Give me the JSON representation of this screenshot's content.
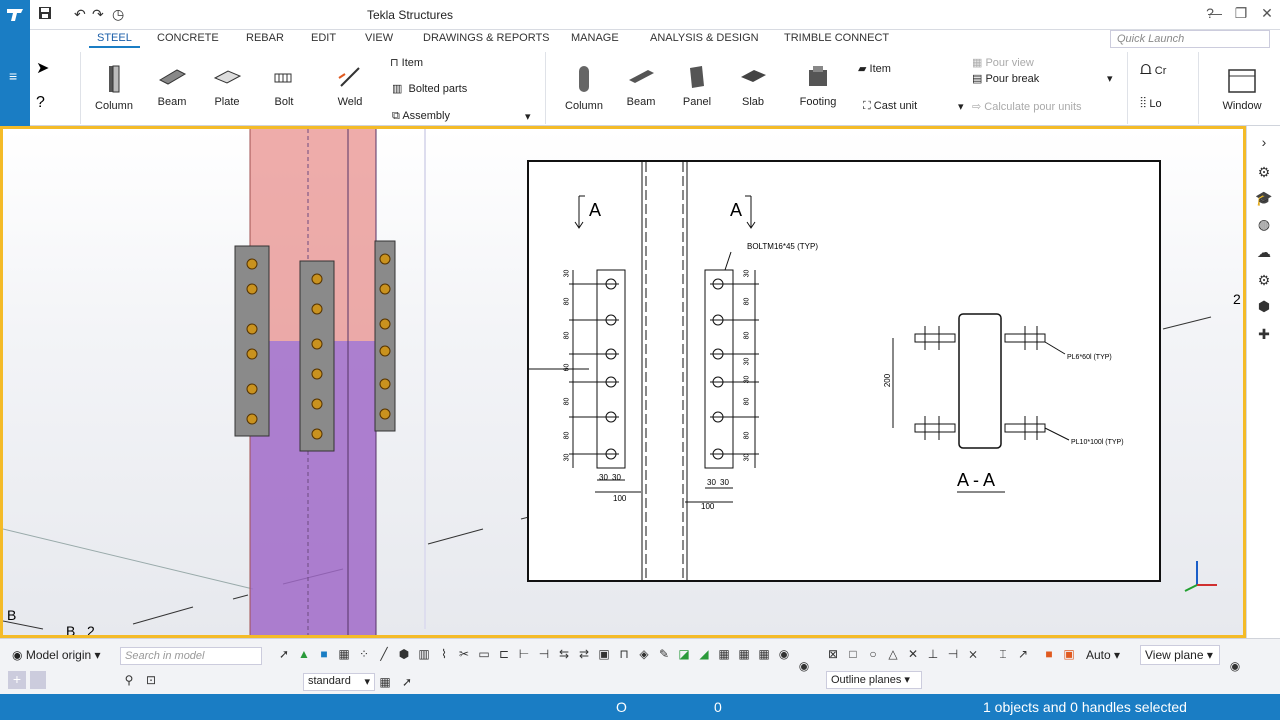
{
  "app": {
    "title": "Tekla Structures"
  },
  "tabs": [
    "STEEL",
    "CONCRETE",
    "REBAR",
    "EDIT",
    "VIEW",
    "DRAWINGS & REPORTS",
    "MANAGE",
    "ANALYSIS & DESIGN",
    "TRIMBLE CONNECT"
  ],
  "quick_launch_placeholder": "Quick Launch",
  "ribbon": {
    "steel": [
      "Column",
      "Beam",
      "Plate",
      "Bolt",
      "Weld"
    ],
    "steel_small": [
      "Item",
      "Bolted parts",
      "Assembly"
    ],
    "concrete": [
      "Column",
      "Beam",
      "Panel",
      "Slab",
      "Footing"
    ],
    "concrete_small": [
      "Item",
      "Cast unit"
    ],
    "pour": [
      "Pour view",
      "Pour break",
      "Calculate pour units"
    ],
    "right": [
      "Cr",
      "Lo",
      "Window"
    ]
  },
  "drawing": {
    "section_mark": "A",
    "section_title": "A - A",
    "bolt_note": "BOLTM16*45 (TYP)",
    "plate_note_1": "PL6*60l (TYP)",
    "plate_note_2": "PL10*100l (TYP)",
    "left_dims": [
      "30",
      "80",
      "80",
      "60",
      "80",
      "80",
      "30"
    ],
    "right_dims": [
      "30",
      "80",
      "80",
      "30",
      "30",
      "80",
      "80",
      "30"
    ],
    "bottom_dims": [
      "30",
      "30",
      "100"
    ],
    "height_dim": "200"
  },
  "grid_labels": {
    "b": "B",
    "b2": "B",
    "n2": "2",
    "right2": "2"
  },
  "bottom": {
    "origin": "Model origin",
    "search_placeholder": "Search in model",
    "filter": "standard",
    "auto": "Auto",
    "view_plane": "View plane",
    "outline_planes": "Outline planes"
  },
  "status": {
    "o": "O",
    "zero": "0",
    "selection": "1 objects and 0 handles selected"
  },
  "colors": {
    "accent": "#1a7dc4",
    "viewport_border": "#f4bb28",
    "column_upper": "#e8908e",
    "column_lower": "#a06ac8"
  }
}
